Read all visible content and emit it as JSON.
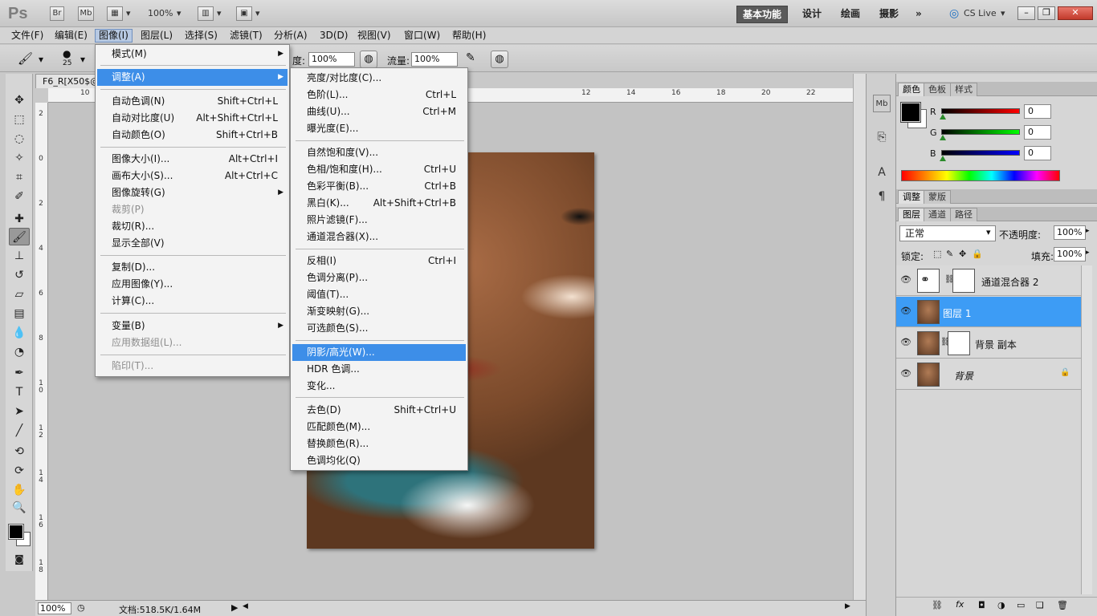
{
  "appbar": {
    "logo": "Ps",
    "br_label": "Br",
    "mb_label": "Mb",
    "zoom": "100%",
    "workspaces": [
      "基本功能",
      "设计",
      "绘画",
      "摄影"
    ],
    "more": "»",
    "cs_live": "CS Live"
  },
  "menubar": [
    "文件(F)",
    "编辑(E)",
    "图像(I)",
    "图层(L)",
    "选择(S)",
    "滤镜(T)",
    "分析(A)",
    "3D(D)",
    "视图(V)",
    "窗口(W)",
    "帮助(H)"
  ],
  "options": {
    "brush_size": "25",
    "opacity_label": "度:",
    "opacity_value": "100%",
    "flow_label": "流量:",
    "flow_value": "100%"
  },
  "document": {
    "tab_title": "F6_R[X50$@",
    "ruler_h": [
      "10",
      "12",
      "14",
      "16",
      "18",
      "20",
      "22"
    ],
    "ruler_v": [
      "2",
      "0",
      "2",
      "4",
      "6",
      "8",
      "1\n0",
      "1\n2",
      "1\n4",
      "1\n6",
      "1\n8"
    ],
    "zoom": "100%",
    "doc_info": "文档:518.5K/1.64M"
  },
  "image_menu": {
    "items": [
      {
        "label": "模式(M)",
        "shortcut": "",
        "submenu": true,
        "disabled": false
      },
      {
        "label": "调整(A)",
        "shortcut": "",
        "submenu": true,
        "disabled": false
      },
      {
        "label": "自动色调(N)",
        "shortcut": "Shift+Ctrl+L",
        "submenu": false,
        "disabled": false
      },
      {
        "label": "自动对比度(U)",
        "shortcut": "Alt+Shift+Ctrl+L",
        "submenu": false,
        "disabled": false
      },
      {
        "label": "自动颜色(O)",
        "shortcut": "Shift+Ctrl+B",
        "submenu": false,
        "disabled": false
      },
      {
        "label": "图像大小(I)...",
        "shortcut": "Alt+Ctrl+I",
        "submenu": false,
        "disabled": false
      },
      {
        "label": "画布大小(S)...",
        "shortcut": "Alt+Ctrl+C",
        "submenu": false,
        "disabled": false
      },
      {
        "label": "图像旋转(G)",
        "shortcut": "",
        "submenu": true,
        "disabled": false
      },
      {
        "label": "裁剪(P)",
        "shortcut": "",
        "submenu": false,
        "disabled": true
      },
      {
        "label": "裁切(R)...",
        "shortcut": "",
        "submenu": false,
        "disabled": false
      },
      {
        "label": "显示全部(V)",
        "shortcut": "",
        "submenu": false,
        "disabled": false
      },
      {
        "label": "复制(D)...",
        "shortcut": "",
        "submenu": false,
        "disabled": false
      },
      {
        "label": "应用图像(Y)...",
        "shortcut": "",
        "submenu": false,
        "disabled": false
      },
      {
        "label": "计算(C)...",
        "shortcut": "",
        "submenu": false,
        "disabled": false
      },
      {
        "label": "变量(B)",
        "shortcut": "",
        "submenu": true,
        "disabled": false
      },
      {
        "label": "应用数据组(L)...",
        "shortcut": "",
        "submenu": false,
        "disabled": true
      },
      {
        "label": "陷印(T)...",
        "shortcut": "",
        "submenu": false,
        "disabled": true
      }
    ]
  },
  "adjust_menu": {
    "items": [
      {
        "label": "亮度/对比度(C)...",
        "shortcut": ""
      },
      {
        "label": "色阶(L)...",
        "shortcut": "Ctrl+L"
      },
      {
        "label": "曲线(U)...",
        "shortcut": "Ctrl+M"
      },
      {
        "label": "曝光度(E)...",
        "shortcut": ""
      },
      {
        "label": "自然饱和度(V)...",
        "shortcut": ""
      },
      {
        "label": "色相/饱和度(H)...",
        "shortcut": "Ctrl+U"
      },
      {
        "label": "色彩平衡(B)...",
        "shortcut": "Ctrl+B"
      },
      {
        "label": "黑白(K)...",
        "shortcut": "Alt+Shift+Ctrl+B"
      },
      {
        "label": "照片滤镜(F)...",
        "shortcut": ""
      },
      {
        "label": "通道混合器(X)...",
        "shortcut": ""
      },
      {
        "label": "反相(I)",
        "shortcut": "Ctrl+I"
      },
      {
        "label": "色调分离(P)...",
        "shortcut": ""
      },
      {
        "label": "阈值(T)...",
        "shortcut": ""
      },
      {
        "label": "渐变映射(G)...",
        "shortcut": ""
      },
      {
        "label": "可选颜色(S)...",
        "shortcut": ""
      },
      {
        "label": "阴影/高光(W)...",
        "shortcut": ""
      },
      {
        "label": "HDR 色调...",
        "shortcut": ""
      },
      {
        "label": "变化...",
        "shortcut": ""
      },
      {
        "label": "去色(D)",
        "shortcut": "Shift+Ctrl+U"
      },
      {
        "label": "匹配颜色(M)...",
        "shortcut": ""
      },
      {
        "label": "替换颜色(R)...",
        "shortcut": ""
      },
      {
        "label": "色调均化(Q)",
        "shortcut": ""
      }
    ]
  },
  "color_panel": {
    "tabs": [
      "颜色",
      "色板",
      "样式"
    ],
    "channels": [
      {
        "label": "R",
        "value": "0",
        "color": "#ff0000"
      },
      {
        "label": "G",
        "value": "0",
        "color": "#00ff00"
      },
      {
        "label": "B",
        "value": "0",
        "color": "#0000ff"
      }
    ]
  },
  "adjust_panel": {
    "tabs": [
      "调整",
      "蒙版"
    ]
  },
  "layers_panel": {
    "tabs": [
      "图层",
      "通道",
      "路径"
    ],
    "blend_mode": "正常",
    "opacity_label": "不透明度:",
    "opacity": "100%",
    "lock_label": "锁定:",
    "fill_label": "填充:",
    "fill": "100%",
    "layers": [
      {
        "name": "通道混合器 2"
      },
      {
        "name": "图层 1"
      },
      {
        "name": "背景 副本"
      },
      {
        "name": "背景"
      }
    ]
  },
  "colors": {
    "highlight": "#3d8ee8",
    "layer_selected": "#3d9cf5"
  }
}
